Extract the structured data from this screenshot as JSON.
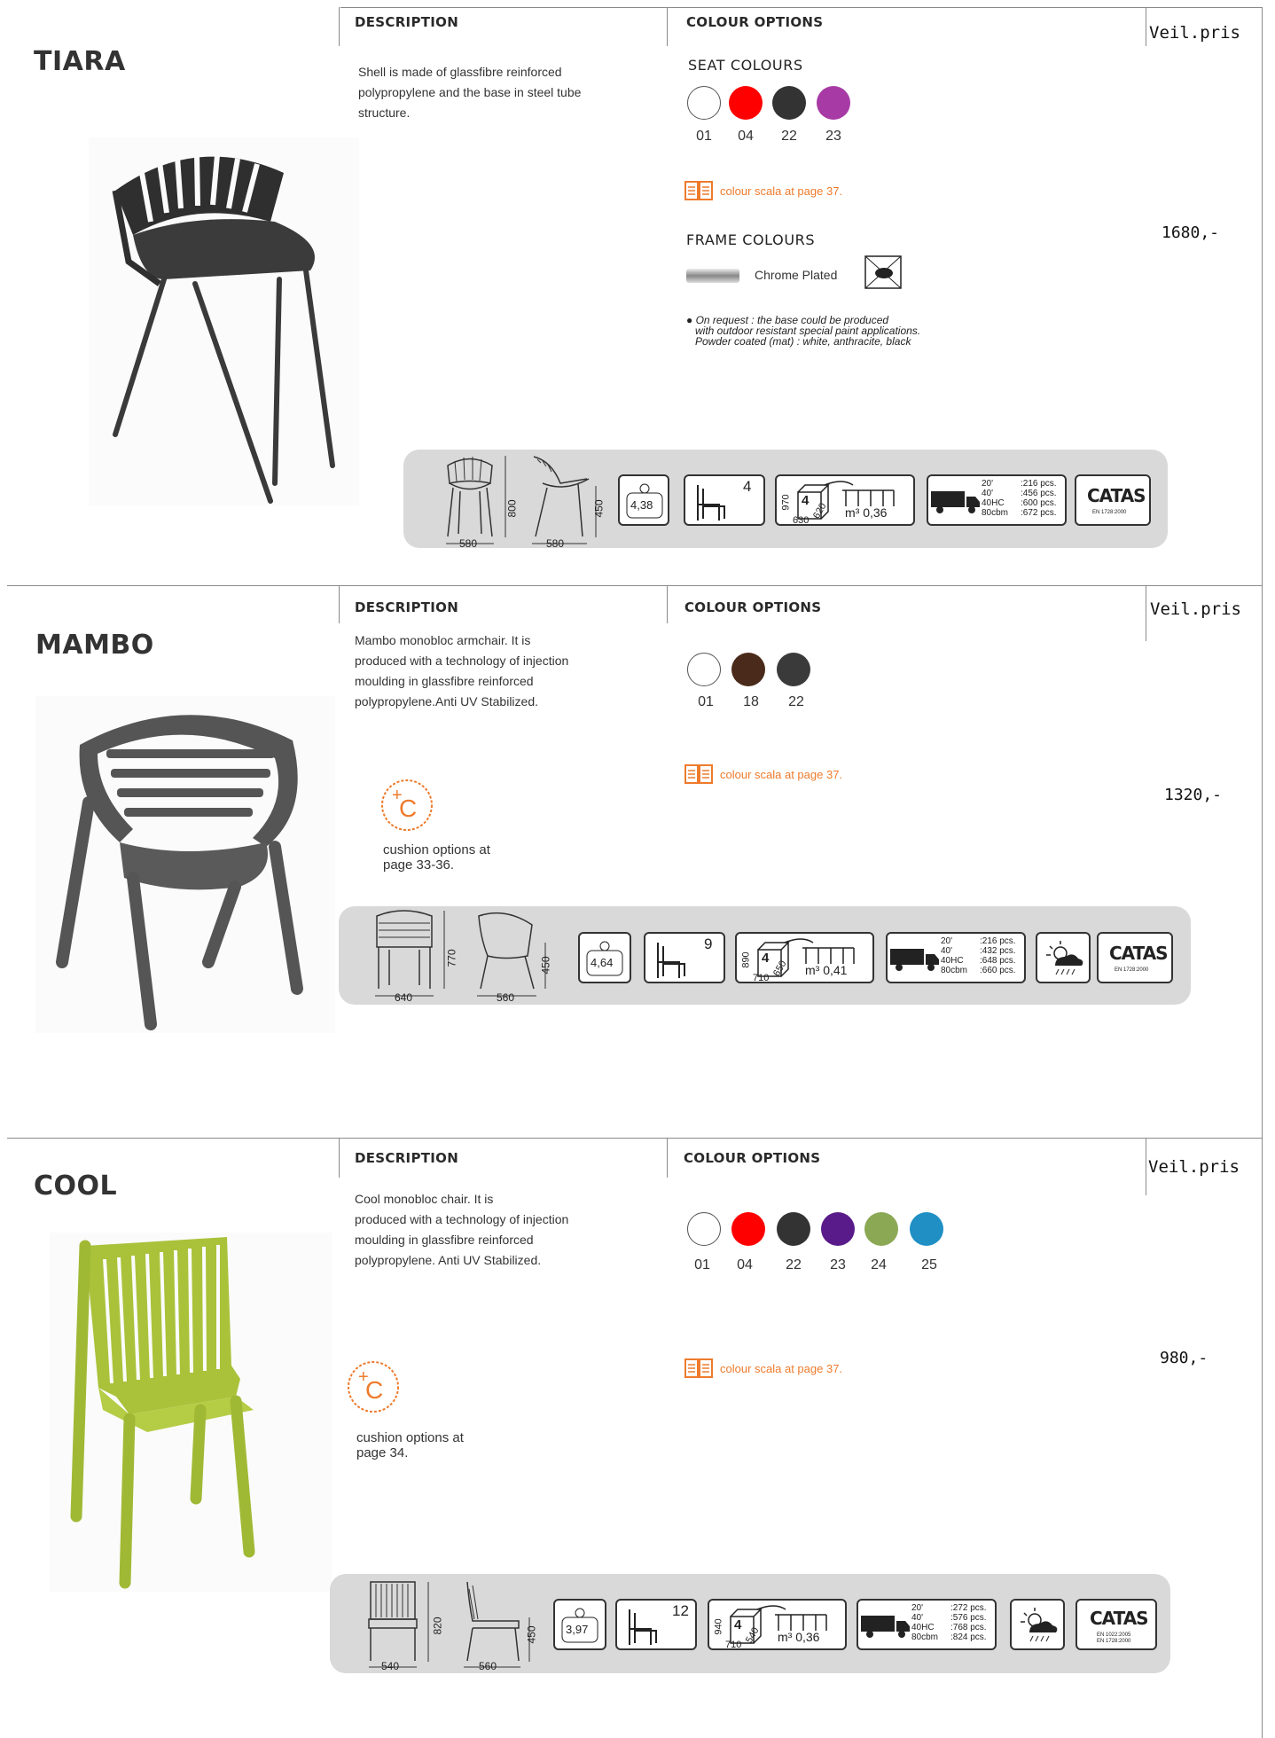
{
  "labels": {
    "description": "DESCRIPTION",
    "colour_options": "COLOUR OPTIONS",
    "price_label": "Veil.pris",
    "colour_scala": "colour scala at page 37."
  },
  "products": [
    {
      "name": "TIARA",
      "description": [
        "Shell is made of glassfibre reinforced",
        "polypropylene and the base in steel tube",
        "structure."
      ],
      "seat_colours_label": "SEAT COLOURS",
      "swatches": [
        {
          "code": "01",
          "color": "#ffffff"
        },
        {
          "code": "04",
          "color": "#ff0000"
        },
        {
          "code": "22",
          "color": "#333333"
        },
        {
          "code": "23",
          "color": "#a83aa6"
        }
      ],
      "frame_colours_label": "FRAME COLOURS",
      "frame_finish": "Chrome Plated",
      "note": [
        "On request : the base could be produced",
        "with outdoor resistant special paint applications.",
        "Powder coated (mat) : white, anthracite, black"
      ],
      "price": "1680,-",
      "specs": {
        "width_front": "580",
        "height": "800",
        "depth": "580",
        "seat_height": "450",
        "weight": "4,38",
        "stack": "4",
        "box_qty": "4",
        "box_h": "970",
        "box_w": "630",
        "box_d": "620",
        "volume": "m³ 0,36",
        "ship_labels": [
          "20'",
          "40'",
          "40HC",
          "80cbm"
        ],
        "ship_values": [
          ":216 pcs.",
          ":456 pcs.",
          ":600 pcs.",
          ":672 pcs."
        ],
        "cert": "CATAS",
        "cert_std": "EN 1728:2000"
      }
    },
    {
      "name": "MAMBO",
      "description": [
        "Mambo monobloc armchair. It is",
        "produced with a technology of injection",
        "moulding in glassfibre reinforced",
        "polypropylene.Anti UV Stabilized."
      ],
      "swatches": [
        {
          "code": "01",
          "color": "#ffffff"
        },
        {
          "code": "18",
          "color": "#4a2a1a"
        },
        {
          "code": "22",
          "color": "#3a3a3a"
        }
      ],
      "cushion": [
        "cushion options at",
        "page 33-36."
      ],
      "price": "1320,-",
      "specs": {
        "width_front": "640",
        "height": "770",
        "depth": "560",
        "seat_height": "450",
        "weight": "4,64",
        "stack": "9",
        "box_qty": "4",
        "box_h": "890",
        "box_w": "710",
        "box_d": "650",
        "volume": "m³ 0,41",
        "ship_labels": [
          "20'",
          "40'",
          "40HC",
          "80cbm"
        ],
        "ship_values": [
          ":216 pcs.",
          ":432 pcs.",
          ":648 pcs.",
          ":660 pcs."
        ],
        "cert": "CATAS",
        "cert_std": "EN 1728:2000"
      }
    },
    {
      "name": "COOL",
      "description": [
        "Cool monobloc chair. It is",
        "produced with a technology of injection",
        "moulding in glassfibre reinforced",
        "polypropylene. Anti UV Stabilized."
      ],
      "swatches": [
        {
          "code": "01",
          "color": "#ffffff"
        },
        {
          "code": "04",
          "color": "#ff0000"
        },
        {
          "code": "22",
          "color": "#333333"
        },
        {
          "code": "23",
          "color": "#5a1b8a"
        },
        {
          "code": "24",
          "color": "#8ba854"
        },
        {
          "code": "25",
          "color": "#1f8fc4"
        }
      ],
      "cushion": [
        "cushion options at",
        "page 34."
      ],
      "price": "980,-",
      "specs": {
        "width_front": "540",
        "height": "820",
        "depth": "560",
        "seat_height": "450",
        "weight": "3,97",
        "stack": "12",
        "box_qty": "4",
        "box_h": "940",
        "box_w": "710",
        "box_d": "540",
        "volume": "m³ 0,36",
        "ship_labels": [
          "20'",
          "40'",
          "40HC",
          "80cbm"
        ],
        "ship_values": [
          ":272 pcs.",
          ":576 pcs.",
          ":768 pcs.",
          ":824 pcs."
        ],
        "cert": "CATAS",
        "cert_std": "EN 1022:2005\nEN 1728:2000"
      }
    }
  ]
}
